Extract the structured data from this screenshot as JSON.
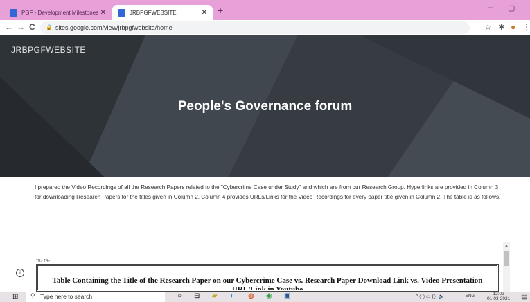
{
  "browser": {
    "tabs": [
      {
        "title": "PGF - Development Milestones",
        "close": "✕"
      },
      {
        "title": "JRBPGFWEBSITE",
        "close": "✕"
      }
    ],
    "new_tab": "+",
    "window_controls": {
      "minimize": "–",
      "maximize": "▢"
    },
    "nav": {
      "back": "←",
      "forward": "→",
      "reload": "C"
    },
    "url": "sites.google.com/view/jrbpgfwebsite/home",
    "lock_icon": "🔒",
    "star_icon": "☆",
    "extensions_icon": "✱",
    "profile_icon": "●",
    "menu_icon": "⋮"
  },
  "site": {
    "name": "JRBPGFWEBSITE",
    "hero_title": "People's Governance forum",
    "paragraph": "I prepared the Video Recordings of all the Research Papers related to the \"Cybercrime Case under Study\" and which are from our Research Group. Hyperlinks are provided in Column 3 for downloading Research Papers for the titles given in Column 2. Column 4 provides URLs/Links for the Video Recordings for every paper title given in Column 2. The table is as follows.",
    "tr_text": "TR> TR>",
    "table_title": "Table Containing the Title of the Research Paper on our Cybercrime Case vs. Research Paper Download Link vs. Video Presentation URL/Link in Youtube",
    "info_icon": "i"
  },
  "taskbar": {
    "start_icon": "⊞",
    "search_placeholder": "Type here to search",
    "search_icon": "⚲",
    "apps": [
      "○",
      "⊟",
      "▰",
      "◐",
      "◍",
      "◉",
      "▣"
    ],
    "tray": "^ ◯ ▭ ((( 🔈",
    "lang": "ENG",
    "time": "12:02",
    "date": "01-03-2021",
    "notification_icon": "▤"
  },
  "colors": {
    "tabbar": "#e8a0d8",
    "hero_bg": "#3a4046",
    "taskbar": "#e7e2e6"
  }
}
